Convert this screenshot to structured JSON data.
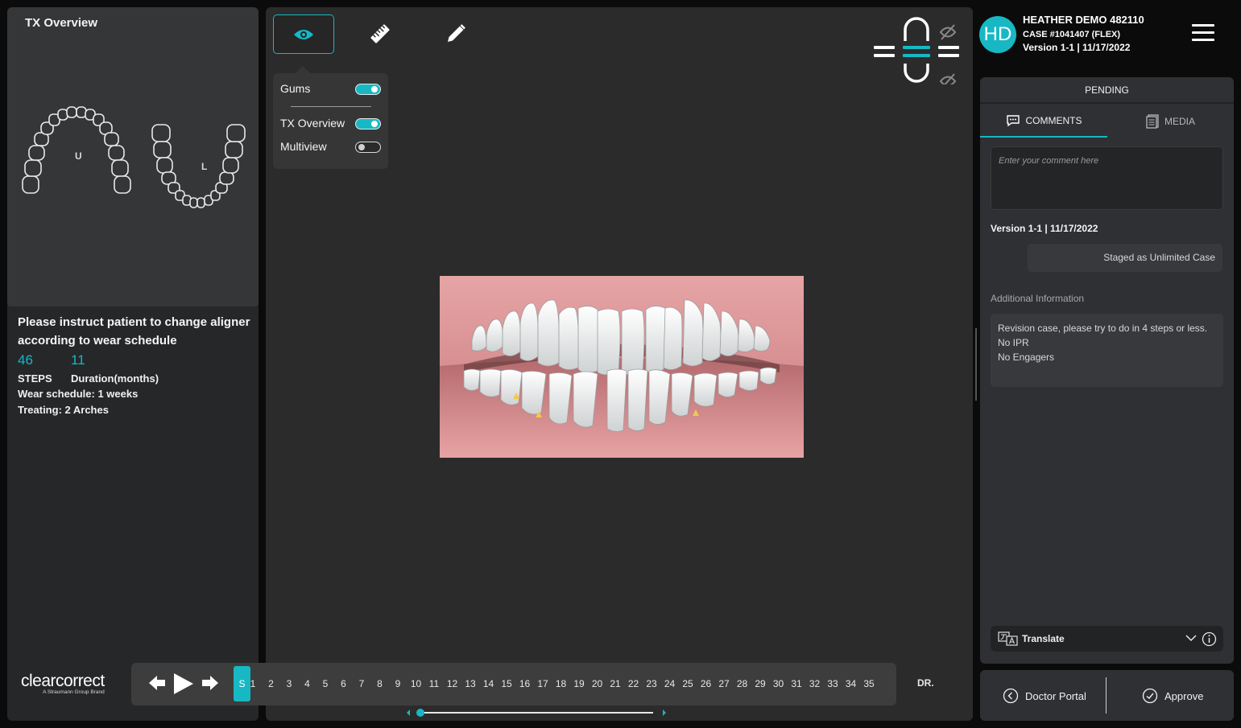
{
  "left": {
    "title": "TX Overview",
    "upper_label": "U",
    "lower_label": "L",
    "instruction": "Please instruct patient to change aligner according to wear schedule",
    "steps_value": "46",
    "duration_value": "11",
    "steps_label": "STEPS",
    "duration_label": "Duration(months)",
    "wear_schedule": "Wear schedule: 1 weeks",
    "treating": "Treating: 2 Arches",
    "brand_name": "clearcorrect",
    "brand_sub": "A Straumann Group Brand"
  },
  "toolbar": {
    "view_icon": "eye-icon",
    "measure_icon": "ruler-icon",
    "edit_icon": "pencil-icon"
  },
  "view_menu": {
    "items": [
      {
        "label": "Gums",
        "on": true
      },
      {
        "label": "TX Overview",
        "on": true
      },
      {
        "label": "Multiview",
        "on": false
      }
    ]
  },
  "timeline": {
    "current_step": "S",
    "steps": [
      "1",
      "2",
      "3",
      "4",
      "5",
      "6",
      "7",
      "8",
      "9",
      "10",
      "11",
      "12",
      "13",
      "14",
      "15",
      "16",
      "17",
      "18",
      "19",
      "20",
      "21",
      "22",
      "23",
      "24",
      "25",
      "26",
      "27",
      "28",
      "29",
      "30",
      "31",
      "32",
      "33",
      "34",
      "35"
    ],
    "end_label": "DR.",
    "scrub_position": 0.0
  },
  "header": {
    "initials": "HD",
    "patient_name": "HEATHER DEMO 482110",
    "case": "CASE #1041407 (FLEX)",
    "version": "Version 1-1 | 11/17/2022"
  },
  "right": {
    "status": "PENDING",
    "tab_comments": "COMMENTS",
    "tab_media": "MEDIA",
    "comment_placeholder": "Enter your comment here",
    "version": "Version 1-1 | 11/17/2022",
    "staged": "Staged as Unlimited Case",
    "additional_title": "Additional Information",
    "additional_lines": [
      "Revision case, please try to do in 4 steps or less.",
      "No IPR",
      "No Engagers"
    ],
    "translate": "Translate"
  },
  "footer": {
    "doctor_portal": "Doctor Portal",
    "approve": "Approve"
  },
  "colors": {
    "accent": "#17b8c4",
    "gum": "#e49a9b",
    "marker": "#f2c94c"
  }
}
